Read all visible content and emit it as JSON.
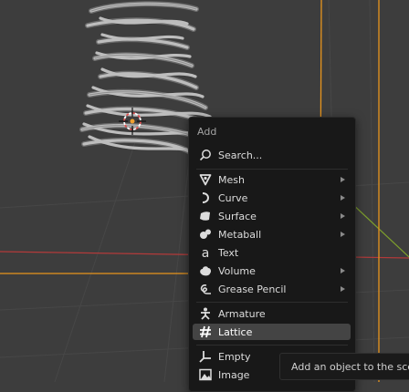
{
  "menu": {
    "title": "Add",
    "items": [
      {
        "label": "Search...",
        "icon": "search-icon",
        "submenu": false
      },
      {
        "label": "Mesh",
        "icon": "mesh-icon",
        "submenu": true
      },
      {
        "label": "Curve",
        "icon": "curve-icon",
        "submenu": true
      },
      {
        "label": "Surface",
        "icon": "surface-icon",
        "submenu": true
      },
      {
        "label": "Metaball",
        "icon": "metaball-icon",
        "submenu": true
      },
      {
        "label": "Text",
        "icon": "text-icon",
        "submenu": false
      },
      {
        "label": "Volume",
        "icon": "volume-icon",
        "submenu": true
      },
      {
        "label": "Grease Pencil",
        "icon": "grease-pencil-icon",
        "submenu": true
      },
      {
        "label": "Armature",
        "icon": "armature-icon",
        "submenu": false
      },
      {
        "label": "Lattice",
        "icon": "lattice-icon",
        "submenu": false,
        "highlighted": true
      },
      {
        "label": "Empty",
        "icon": "empty-icon",
        "submenu": true
      },
      {
        "label": "Image",
        "icon": "image-icon",
        "submenu": true
      }
    ]
  },
  "tooltip": {
    "text": "Add an object to the sce"
  },
  "colors": {
    "viewport_bg": "#3d3d3d",
    "menu_bg": "#181818",
    "highlight": "#444444",
    "axis_x": "#b33a3a",
    "axis_y": "#7ea02c",
    "camera_frame": "#e8951d"
  }
}
